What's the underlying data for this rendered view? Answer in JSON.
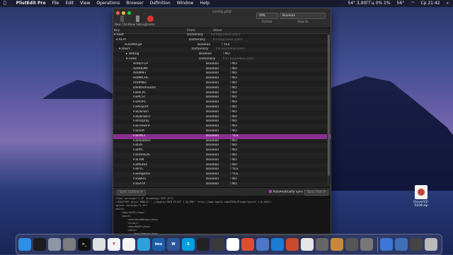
{
  "menubar": {
    "apple": "",
    "app": "PlistEdit Pro",
    "items": [
      "File",
      "Edit",
      "View",
      "Operations",
      "Browser",
      "Definition",
      "Window",
      "Help"
    ],
    "status": "54° 3,90ГГц 0% 1%",
    "temp": "56°",
    "clock": "Ср 21:42"
  },
  "window": {
    "title": "config.plist",
    "toolbar": {
      "new_child": "New Child",
      "new_sibling": "New Sibling",
      "delete": "Delete"
    },
    "format": {
      "value": "XML",
      "label": "Format"
    },
    "view_as": {
      "value": "Boolean",
      "label": "View As"
    },
    "columns": {
      "key": "Key",
      "class": "Class",
      "value": "Value"
    },
    "rows": [
      {
        "key": "▾ Root",
        "class": "Dictionary",
        "value": "8 key/value pairs"
      },
      {
        "key": "▾ ACPI",
        "class": "Dictionary",
        "value": "9 key/value pairs"
      },
      {
        "key": "AutoMerge",
        "class": "Boolean",
        "value": "YES"
      },
      {
        "key": "▾ DSDT",
        "class": "Dictionary",
        "value": "8 key/value pairs"
      },
      {
        "key": "▸ Debug",
        "class": "Boolean",
        "value": "NO"
      },
      {
        "key": "▾ Fixes",
        "class": "Dictionary",
        "value": "27 key/value pairs"
      },
      {
        "key": "AddDTGP",
        "class": "Boolean",
        "value": "NO"
      },
      {
        "key": "AddHDMI",
        "class": "Boolean",
        "value": "NO"
      },
      {
        "key": "AddIMEI",
        "class": "Boolean",
        "value": "NO"
      },
      {
        "key": "AddMCHC",
        "class": "Boolean",
        "value": "NO"
      },
      {
        "key": "AddPNLF",
        "class": "Boolean",
        "value": "NO"
      },
      {
        "key": "DeleteUnused",
        "class": "Boolean",
        "value": "NO"
      },
      {
        "key": "FakeLPC",
        "class": "Boolean",
        "value": "NO"
      },
      {
        "key": "FixACST",
        "class": "Boolean",
        "value": "NO"
      },
      {
        "key": "FixADP1",
        "class": "Boolean",
        "value": "NO"
      },
      {
        "key": "FixAirport",
        "class": "Boolean",
        "value": "NO"
      },
      {
        "key": "FixDarwin",
        "class": "Boolean",
        "value": "NO"
      },
      {
        "key": "FixDarwin7",
        "class": "Boolean",
        "value": "NO"
      },
      {
        "key": "FixDisplay",
        "class": "Boolean",
        "value": "NO"
      },
      {
        "key": "FixFirewire",
        "class": "Boolean",
        "value": "NO"
      },
      {
        "key": "FixHDA",
        "class": "Boolean",
        "value": "NO"
      },
      {
        "key": "FixHPET",
        "class": "Boolean",
        "value": "YES",
        "highlight": true
      },
      {
        "key": "FixHeaders",
        "class": "Boolean",
        "value": "NO"
      },
      {
        "key": "FixIDE",
        "class": "Boolean",
        "value": "NO"
      },
      {
        "key": "FixIPIC",
        "class": "Boolean",
        "value": "NO"
      },
      {
        "key": "FixIntelGfx",
        "class": "Boolean",
        "value": "NO"
      },
      {
        "key": "FixLAN",
        "class": "Boolean",
        "value": "NO"
      },
      {
        "key": "FixMutex",
        "class": "Boolean",
        "value": "NO"
      },
      {
        "key": "FixRTC",
        "class": "Boolean",
        "value": "YES"
      },
      {
        "key": "FixRegions",
        "class": "Boolean",
        "value": "YES"
      },
      {
        "key": "FixSBUS",
        "class": "Boolean",
        "value": "NO"
      },
      {
        "key": "FixSATA",
        "class": "Boolean",
        "value": "NO"
      },
      {
        "key": "FixSBUS",
        "class": "Boolean",
        "value": "NO"
      },
      {
        "key": "FixShutdown",
        "class": "Boolean",
        "value": "NO"
      }
    ],
    "mid": {
      "left_btn": "Sync outline ⟳",
      "sync_label": "Automatically sync text",
      "right_btn": "Sync text ⟳"
    },
    "code_lines": [
      "<?xml version=\"1.0\" encoding=\"UTF-8\"?>",
      "<!DOCTYPE plist PUBLIC \"-//Apple//DTD PLIST 1.0//EN\" \"http://www.apple.com/DTDs/PropertyList-1.0.dtd\">",
      "<plist version=\"1.0\">",
      "<dict>",
      "    <key>ACPI</key>",
      "    <dict>",
      "        <key>AutoMerge</key>",
      "        <true/>",
      "        <key>DSDT</key>",
      "        <dict>",
      "            <key>Debug</key>",
      "            <false/>",
      "            <key>Fixes</key>",
      "            <dict>",
      "                <key>AddDTGP</key>"
    ]
  },
  "desktop_icon": {
    "label": "CloverV2-5109.zip"
  },
  "dock": {
    "apps": [
      {
        "name": "finder",
        "label": "",
        "color": "#2f8ee6"
      },
      {
        "name": "activity",
        "label": "",
        "color": "#1c1c1c"
      },
      {
        "name": "launchpad",
        "label": "",
        "color": "#8c96a8"
      },
      {
        "name": "settings",
        "label": "",
        "color": "#7b7b80"
      },
      {
        "name": "terminal",
        "label": ">_",
        "color": "#111111"
      },
      {
        "name": "ytm",
        "label": "",
        "color": "#e0e0e0"
      },
      {
        "name": "yandex",
        "label": "Y",
        "color": "#f2f2f2"
      },
      {
        "name": "chrome",
        "label": "",
        "color": "#f4f4f4"
      },
      {
        "name": "telegram",
        "label": "",
        "color": "#2aa3dc"
      },
      {
        "name": "imo",
        "label": "imo",
        "color": "#1b5fa8"
      },
      {
        "name": "word",
        "label": "W",
        "color": "#2b5797"
      },
      {
        "name": "skype",
        "label": "S",
        "color": "#00a0e0"
      },
      {
        "name": "obs",
        "label": "",
        "color": "#222222"
      },
      {
        "name": "fcp",
        "label": "",
        "color": "#3a3a3a"
      },
      {
        "name": "photos",
        "label": "",
        "color": "#ffffff"
      },
      {
        "name": "keynote",
        "label": "",
        "color": "#e14c2f"
      },
      {
        "name": "ps",
        "label": "",
        "color": "#4c77c9"
      },
      {
        "name": "app-a",
        "label": "",
        "color": "#1e7bd6"
      },
      {
        "name": "app-b",
        "label": "",
        "color": "#c94a2a"
      },
      {
        "name": "app-c",
        "label": "",
        "color": "#e6e6e6"
      },
      {
        "name": "app-d",
        "label": "",
        "color": "#666666"
      },
      {
        "name": "clover",
        "label": "",
        "color": "#c68a3a"
      },
      {
        "name": "app-e",
        "label": "",
        "color": "#555555"
      },
      {
        "name": "app-f",
        "label": "",
        "color": "#777777"
      },
      {
        "name": "trash-area",
        "label": "",
        "color": "#3b78d8"
      },
      {
        "name": "docs",
        "label": "",
        "color": "#3f6fb5"
      },
      {
        "name": "stack",
        "label": "",
        "color": "#444444"
      },
      {
        "name": "trash",
        "label": "",
        "color": "#bbbbbb"
      }
    ]
  }
}
